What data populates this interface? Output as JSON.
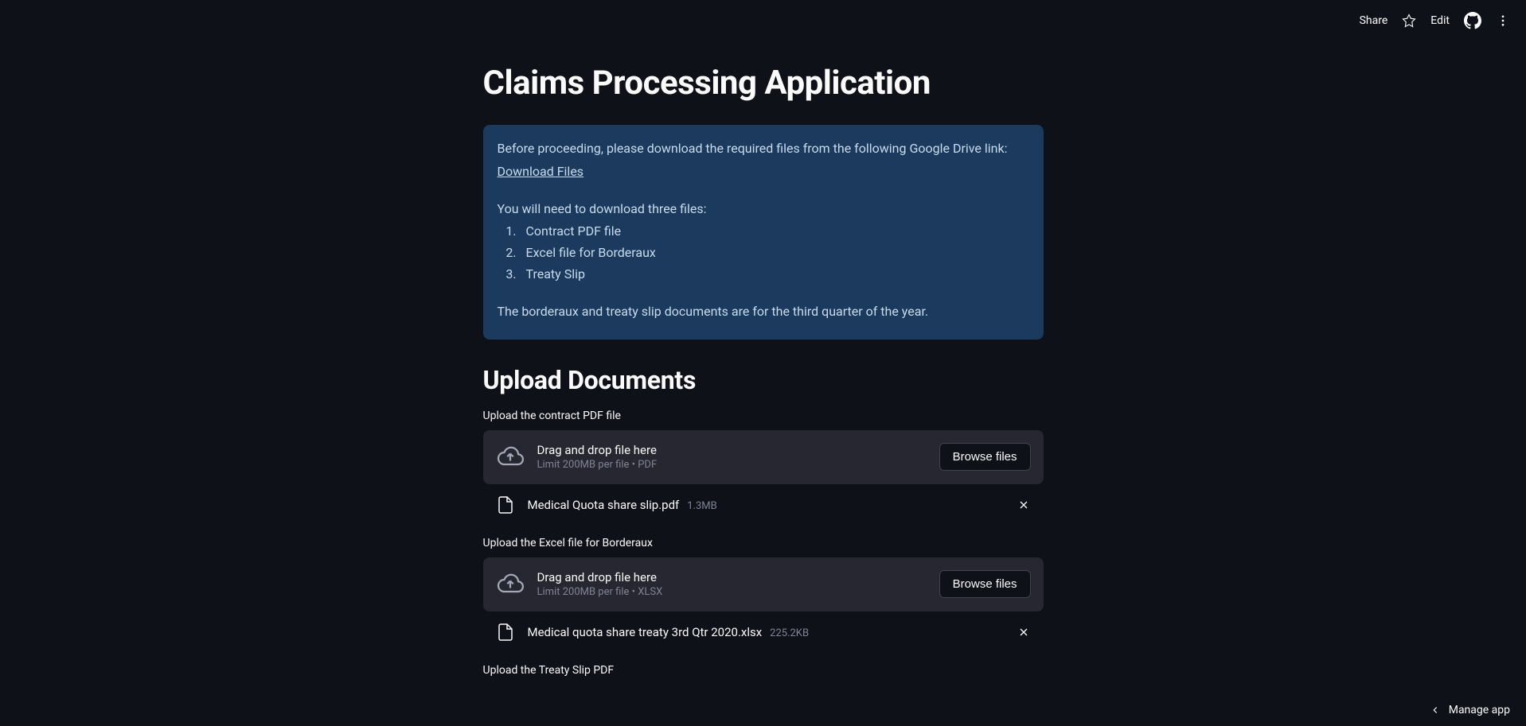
{
  "toolbar": {
    "share": "Share",
    "edit": "Edit"
  },
  "page": {
    "title": "Claims Processing Application"
  },
  "info": {
    "intro": "Before proceeding, please download the required files from the following Google Drive link:",
    "link_text": "Download Files",
    "need_text": "You will need to download three files:",
    "items": [
      "Contract PDF file",
      "Excel file for Borderaux",
      "Treaty Slip"
    ],
    "footer_text": "The borderaux and treaty slip documents are for the third quarter of the year."
  },
  "upload_header": "Upload Documents",
  "uploads": [
    {
      "label": "Upload the contract PDF file",
      "drop_main": "Drag and drop file here",
      "drop_sub": "Limit 200MB per file • PDF",
      "browse": "Browse files",
      "file": {
        "name": "Medical Quota share slip.pdf",
        "size": "1.3MB"
      }
    },
    {
      "label": "Upload the Excel file for Borderaux",
      "drop_main": "Drag and drop file here",
      "drop_sub": "Limit 200MB per file • XLSX",
      "browse": "Browse files",
      "file": {
        "name": "Medical quota share treaty 3rd Qtr 2020.xlsx",
        "size": "225.2KB"
      }
    },
    {
      "label": "Upload the Treaty Slip PDF"
    }
  ],
  "footer": {
    "manage": "Manage app"
  }
}
